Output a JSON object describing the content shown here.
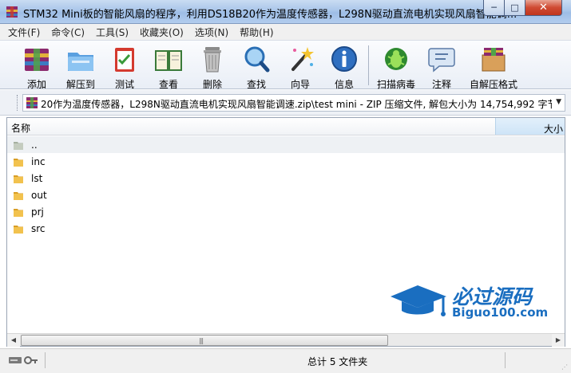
{
  "window": {
    "title": "STM32 Mini板的智能风扇的程序，利用DS18B20作为温度传感器，L298N驱动直流电机实现风扇智能调...",
    "min_glyph": "─",
    "max_glyph": "□",
    "close_glyph": "✕"
  },
  "menu": {
    "items": [
      "文件(F)",
      "命令(C)",
      "工具(S)",
      "收藏夹(O)",
      "选项(N)",
      "帮助(H)"
    ]
  },
  "toolbar": {
    "add": "添加",
    "extract_to": "解压到",
    "test": "测试",
    "view": "查看",
    "delete": "删除",
    "find": "查找",
    "wizard": "向导",
    "info": "信息",
    "virus_scan": "扫描病毒",
    "comment": "注释",
    "sfx": "自解压格式"
  },
  "address": {
    "path": "20作为温度传感器，L298N驱动直流电机实现风扇智能调速.zip\\test mini - ZIP 压缩文件, 解包大小为 14,754,992 字节"
  },
  "filelist": {
    "col_name": "名称",
    "col_size": "大小",
    "sort_glyph": "^",
    "rows": [
      "..",
      "inc",
      "lst",
      "out",
      "prj",
      "src"
    ]
  },
  "watermark": {
    "title": "必过源码",
    "subtitle": "Biguo100.com"
  },
  "scrollbar": {
    "left_glyph": "◀",
    "right_glyph": "▶",
    "grip": "|||"
  },
  "status": {
    "text": "总计 5 文件夹"
  },
  "colors": {
    "title_bar": "#aac6ea",
    "close_button": "#c0361e",
    "folder": "#e8b43a",
    "watermark": "#1a6ec0"
  }
}
